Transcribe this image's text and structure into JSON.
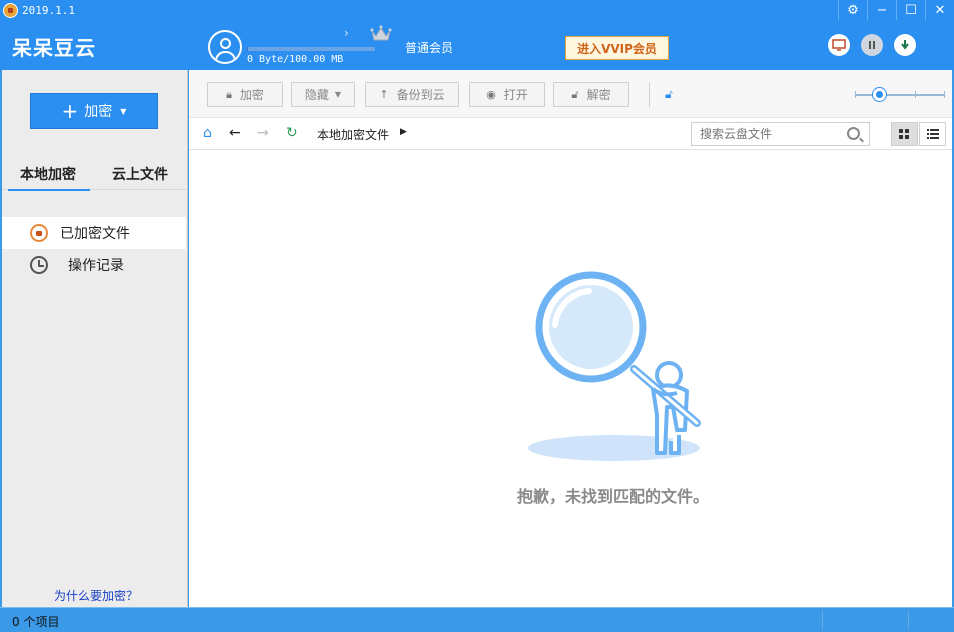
{
  "titlebar": {
    "version": "2019.1.1"
  },
  "header": {
    "brand": "呆呆豆云",
    "storage_text": "0 Byte/100.00 MB",
    "storage_used_fraction": 0.0,
    "member_level": "普通会员",
    "vip_button": "进入VVIP会员"
  },
  "sidebar": {
    "encrypt_button": "加密",
    "tabs": [
      {
        "label": "本地加密"
      },
      {
        "label": "云上文件"
      }
    ],
    "items": [
      {
        "label": "已加密文件",
        "icon": "lock-icon"
      },
      {
        "label": "操作记录",
        "icon": "clock-icon"
      }
    ],
    "help_link": "为什么要加密？"
  },
  "toolbar": {
    "encrypt": "加密",
    "hide": "隐藏",
    "backup": "备份到云",
    "open": "打开",
    "decrypt": "解密"
  },
  "navbar": {
    "path": "本地加密文件",
    "search_placeholder": "搜索云盘文件"
  },
  "main": {
    "empty_message": "抱歉，未找到匹配的文件。"
  },
  "statusbar": {
    "count": "0 个项目"
  },
  "colors": {
    "accent": "#2a8ff0",
    "vip": "#d0641a",
    "statusbar": "#3a9ae8"
  }
}
